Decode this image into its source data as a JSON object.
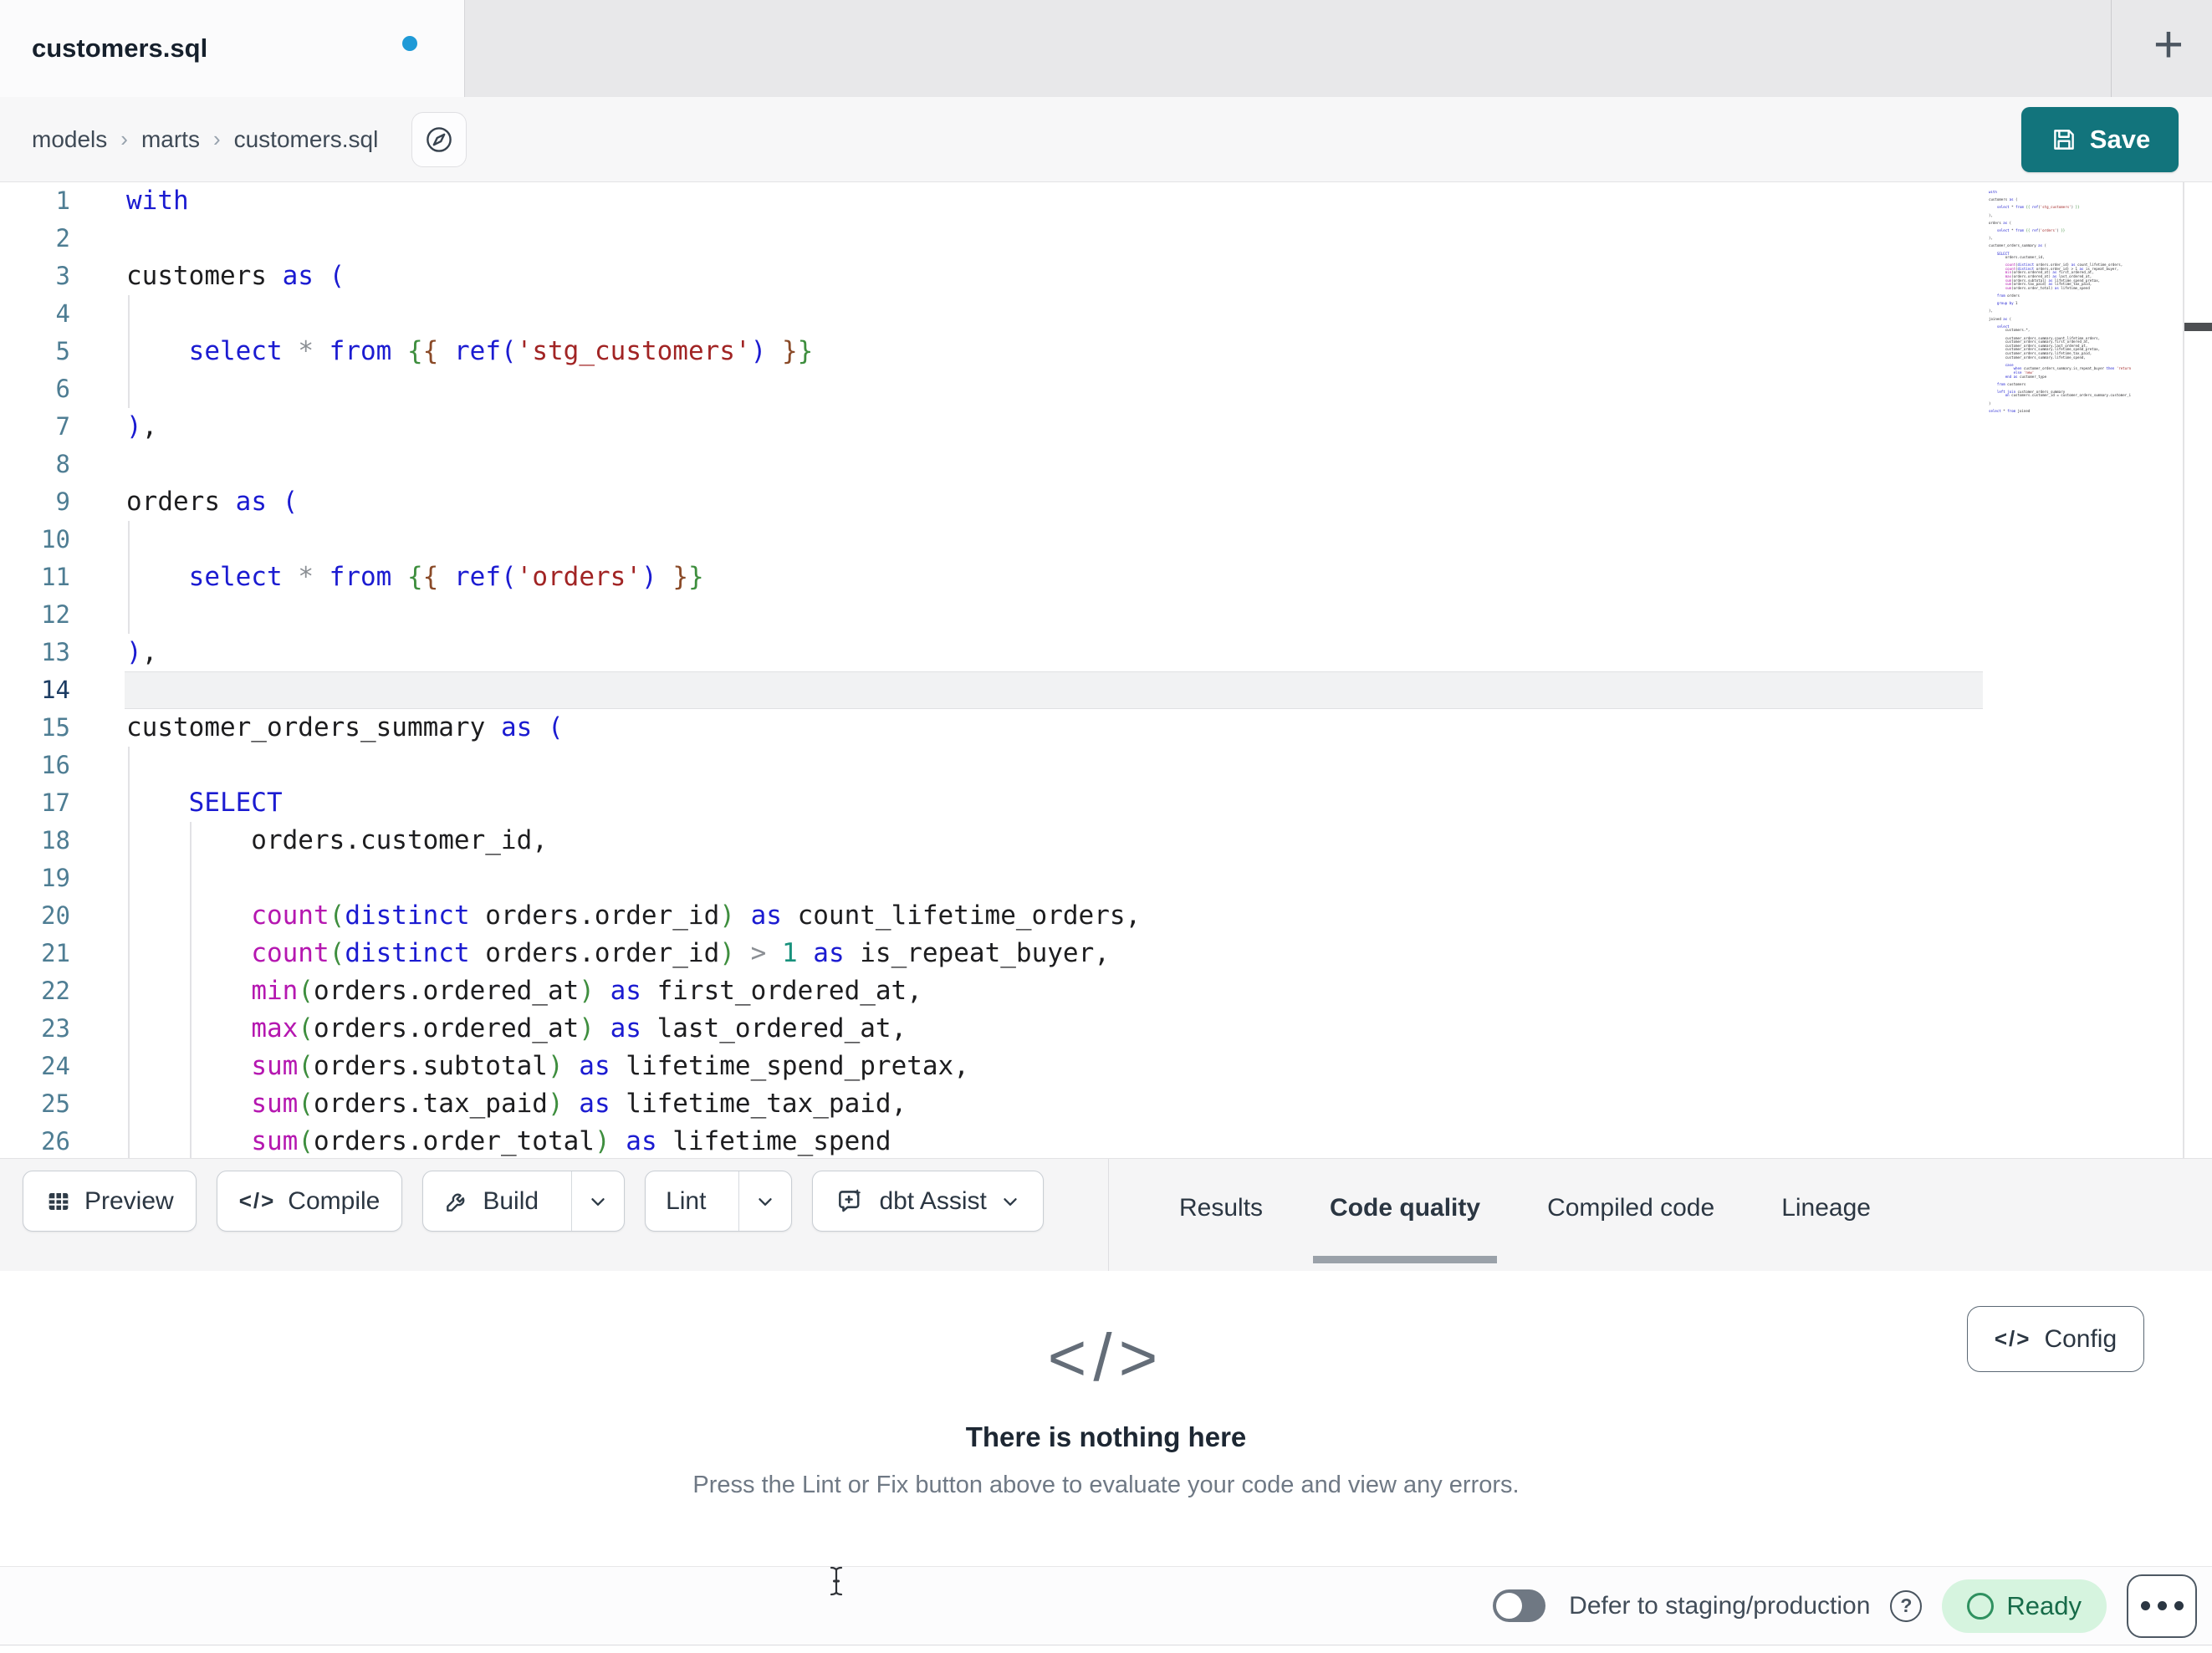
{
  "window": {
    "tab_title": "customers.sql",
    "new_tab_plus": "+"
  },
  "breadcrumb": {
    "items": [
      "models",
      "marts",
      "customers.sql"
    ],
    "separator": "›"
  },
  "actions": {
    "save": "Save"
  },
  "toolbar": {
    "preview": "Preview",
    "compile": "Compile",
    "build": "Build",
    "lint": "Lint",
    "assist": "dbt Assist",
    "compile_glyph": "</>"
  },
  "panel_tabs": {
    "items": [
      "Results",
      "Code quality",
      "Compiled code",
      "Lineage"
    ],
    "active_index": 1
  },
  "empty_state": {
    "icon": "</>",
    "title": "There is nothing here",
    "subtitle": "Press the Lint or Fix button above to evaluate your code and view any errors."
  },
  "config_button": {
    "icon": "</>",
    "label": "Config"
  },
  "status_bar": {
    "defer_label": "Defer to staging/production",
    "help": "?",
    "ready": "Ready"
  },
  "colors": {
    "accent_teal": "#12747c",
    "tab_dot_blue": "#1f9ad7",
    "ready_bg": "#d6f4df",
    "ready_text": "#176b49",
    "keyword_blue": "#1b1bd1",
    "function_magenta": "#b517b0",
    "string_red": "#a12424",
    "jinja_green": "#3e8e3e",
    "jinja_brown": "#8a4a28",
    "number_teal": "#18917c",
    "line_number": "#4e7d93",
    "active_line_number": "#1c3c63",
    "active_line_bg": "#f1f2f3"
  },
  "editor": {
    "active_line": 14,
    "lines": [
      {
        "n": 1,
        "g": [],
        "t": [
          [
            "with",
            "kw"
          ]
        ]
      },
      {
        "n": 2,
        "g": [],
        "t": []
      },
      {
        "n": 3,
        "g": [],
        "t": [
          [
            "customers ",
            "id"
          ],
          [
            "as",
            "kw"
          ],
          [
            " ",
            "id"
          ],
          [
            "(",
            "kw"
          ]
        ]
      },
      {
        "n": 4,
        "g": [
          0
        ],
        "t": []
      },
      {
        "n": 5,
        "g": [
          0
        ],
        "t": [
          [
            "    ",
            "id"
          ],
          [
            "select",
            "kw"
          ],
          [
            " ",
            "id"
          ],
          [
            "*",
            "op"
          ],
          [
            " ",
            "id"
          ],
          [
            "from",
            "kw"
          ],
          [
            " ",
            "id"
          ],
          [
            "{",
            "par"
          ],
          [
            "{",
            "brn"
          ],
          [
            " ",
            "id"
          ],
          [
            "ref",
            "kw"
          ],
          [
            "(",
            "kw"
          ],
          [
            "'stg_customers'",
            "str"
          ],
          [
            ")",
            "kw"
          ],
          [
            " ",
            "id"
          ],
          [
            "}",
            "brn"
          ],
          [
            "}",
            "par"
          ]
        ]
      },
      {
        "n": 6,
        "g": [
          0
        ],
        "t": []
      },
      {
        "n": 7,
        "g": [],
        "t": [
          [
            ")",
            "kw"
          ],
          [
            ",",
            "id"
          ]
        ]
      },
      {
        "n": 8,
        "g": [],
        "t": []
      },
      {
        "n": 9,
        "g": [],
        "t": [
          [
            "orders ",
            "id"
          ],
          [
            "as",
            "kw"
          ],
          [
            " ",
            "id"
          ],
          [
            "(",
            "kw"
          ]
        ]
      },
      {
        "n": 10,
        "g": [
          0
        ],
        "t": []
      },
      {
        "n": 11,
        "g": [
          0
        ],
        "t": [
          [
            "    ",
            "id"
          ],
          [
            "select",
            "kw"
          ],
          [
            " ",
            "id"
          ],
          [
            "*",
            "op"
          ],
          [
            " ",
            "id"
          ],
          [
            "from",
            "kw"
          ],
          [
            " ",
            "id"
          ],
          [
            "{",
            "par"
          ],
          [
            "{",
            "brn"
          ],
          [
            " ",
            "id"
          ],
          [
            "ref",
            "kw"
          ],
          [
            "(",
            "kw"
          ],
          [
            "'orders'",
            "str"
          ],
          [
            ")",
            "kw"
          ],
          [
            " ",
            "id"
          ],
          [
            "}",
            "brn"
          ],
          [
            "}",
            "par"
          ]
        ]
      },
      {
        "n": 12,
        "g": [
          0
        ],
        "t": []
      },
      {
        "n": 13,
        "g": [],
        "t": [
          [
            ")",
            "kw"
          ],
          [
            ",",
            "id"
          ]
        ]
      },
      {
        "n": 14,
        "g": [],
        "t": []
      },
      {
        "n": 15,
        "g": [],
        "t": [
          [
            "customer_orders_summary ",
            "id"
          ],
          [
            "as",
            "kw"
          ],
          [
            " ",
            "id"
          ],
          [
            "(",
            "kw"
          ]
        ]
      },
      {
        "n": 16,
        "g": [
          0
        ],
        "t": []
      },
      {
        "n": 17,
        "g": [
          0
        ],
        "t": [
          [
            "    ",
            "id"
          ],
          [
            "SELECT",
            "kw"
          ]
        ]
      },
      {
        "n": 18,
        "g": [
          0,
          1
        ],
        "t": [
          [
            "        orders.customer_id,",
            "id"
          ]
        ]
      },
      {
        "n": 19,
        "g": [
          0,
          1
        ],
        "t": []
      },
      {
        "n": 20,
        "g": [
          0,
          1
        ],
        "t": [
          [
            "        ",
            "id"
          ],
          [
            "count",
            "fn"
          ],
          [
            "(",
            "par"
          ],
          [
            "distinct",
            "kw"
          ],
          [
            " orders.order_id",
            "id"
          ],
          [
            ")",
            "par"
          ],
          [
            " ",
            "id"
          ],
          [
            "as",
            "kw"
          ],
          [
            " count_lifetime_orders,",
            "id"
          ]
        ]
      },
      {
        "n": 21,
        "g": [
          0,
          1
        ],
        "t": [
          [
            "        ",
            "id"
          ],
          [
            "count",
            "fn"
          ],
          [
            "(",
            "par"
          ],
          [
            "distinct",
            "kw"
          ],
          [
            " orders.order_id",
            "id"
          ],
          [
            ")",
            "par"
          ],
          [
            " ",
            "id"
          ],
          [
            ">",
            "op"
          ],
          [
            " ",
            "id"
          ],
          [
            "1",
            "num"
          ],
          [
            " ",
            "id"
          ],
          [
            "as",
            "kw"
          ],
          [
            " is_repeat_buyer,",
            "id"
          ]
        ]
      },
      {
        "n": 22,
        "g": [
          0,
          1
        ],
        "t": [
          [
            "        ",
            "id"
          ],
          [
            "min",
            "fn"
          ],
          [
            "(",
            "par"
          ],
          [
            "orders.ordered_at",
            "id"
          ],
          [
            ")",
            "par"
          ],
          [
            " ",
            "id"
          ],
          [
            "as",
            "kw"
          ],
          [
            " first_ordered_at,",
            "id"
          ]
        ]
      },
      {
        "n": 23,
        "g": [
          0,
          1
        ],
        "t": [
          [
            "        ",
            "id"
          ],
          [
            "max",
            "fn"
          ],
          [
            "(",
            "par"
          ],
          [
            "orders.ordered_at",
            "id"
          ],
          [
            ")",
            "par"
          ],
          [
            " ",
            "id"
          ],
          [
            "as",
            "kw"
          ],
          [
            " last_ordered_at,",
            "id"
          ]
        ]
      },
      {
        "n": 24,
        "g": [
          0,
          1
        ],
        "t": [
          [
            "        ",
            "id"
          ],
          [
            "sum",
            "fn"
          ],
          [
            "(",
            "par"
          ],
          [
            "orders.subtotal",
            "id"
          ],
          [
            ")",
            "par"
          ],
          [
            " ",
            "id"
          ],
          [
            "as",
            "kw"
          ],
          [
            " lifetime_spend_pretax,",
            "id"
          ]
        ]
      },
      {
        "n": 25,
        "g": [
          0,
          1
        ],
        "t": [
          [
            "        ",
            "id"
          ],
          [
            "sum",
            "fn"
          ],
          [
            "(",
            "par"
          ],
          [
            "orders.tax_paid",
            "id"
          ],
          [
            ")",
            "par"
          ],
          [
            " ",
            "id"
          ],
          [
            "as",
            "kw"
          ],
          [
            " lifetime_tax_paid,",
            "id"
          ]
        ]
      },
      {
        "n": 26,
        "g": [
          0,
          1
        ],
        "t": [
          [
            "        ",
            "id"
          ],
          [
            "sum",
            "fn"
          ],
          [
            "(",
            "par"
          ],
          [
            "orders.order_total",
            "id"
          ],
          [
            ")",
            "par"
          ],
          [
            " ",
            "id"
          ],
          [
            "as",
            "kw"
          ],
          [
            " lifetime_spend",
            "id"
          ]
        ]
      }
    ],
    "minimap_lines": [
      "with",
      "",
      "customers as (",
      "",
      "    select * from {{ ref('stg_customers') }}",
      "",
      "),",
      "",
      "orders as (",
      "",
      "    select * from {{ ref('orders') }}",
      "",
      "),",
      "",
      "customer_orders_summary as (",
      "",
      "    SELECT",
      "        orders.customer_id,",
      "",
      "        count(distinct orders.order_id) as count_lifetime_orders,",
      "        count(distinct orders.order_id) > 1 as is_repeat_buyer,",
      "        min(orders.ordered_at) as first_ordered_at,",
      "        max(orders.ordered_at) as last_ordered_at,",
      "        sum(orders.subtotal) as lifetime_spend_pretax,",
      "        sum(orders.tax_paid) as lifetime_tax_paid,",
      "        sum(orders.order_total) as lifetime_spend",
      "",
      "    from orders",
      "",
      "    group by 1",
      "",
      "),",
      "",
      "joined as (",
      "",
      "    select",
      "        customers.*,",
      "",
      "        customer_orders_summary.count_lifetime_orders,",
      "        customer_orders_summary.first_ordered_at,",
      "        customer_orders_summary.last_ordered_at,",
      "        customer_orders_summary.lifetime_spend_pretax,",
      "        customer_orders_summary.lifetime_tax_paid,",
      "        customer_orders_summary.lifetime_spend,",
      "",
      "        case",
      "            when customer_orders_summary.is_repeat_buyer then 'returning'",
      "            else 'new'",
      "        end as customer_type",
      "",
      "    from customers",
      "",
      "    left join customer_orders_summary",
      "        on customers.customer_id = customer_orders_summary.customer_id",
      "",
      ")",
      "",
      "select * from joined"
    ]
  }
}
